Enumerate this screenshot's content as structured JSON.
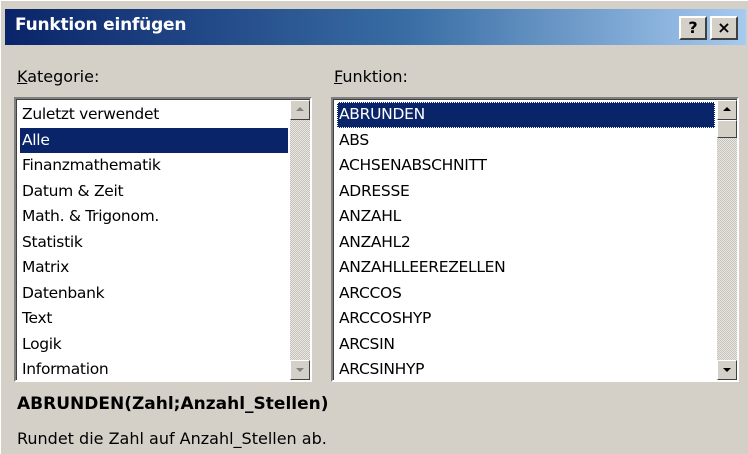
{
  "window": {
    "title": "Funktion einfügen",
    "help_button": "?",
    "close_button": "×"
  },
  "category": {
    "label_mnemonic": "K",
    "label_rest": "ategorie:",
    "items": [
      "Zuletzt verwendet",
      "Alle",
      "Finanzmathematik",
      "Datum & Zeit",
      "Math. & Trigonom.",
      "Statistik",
      "Matrix",
      "Datenbank",
      "Text",
      "Logik",
      "Information"
    ],
    "selected": "Alle"
  },
  "function": {
    "label_mnemonic": "F",
    "label_rest": "unktion:",
    "items": [
      "ABRUNDEN",
      "ABS",
      "ACHSENABSCHNITT",
      "ADRESSE",
      "ANZAHL",
      "ANZAHL2",
      "ANZAHLLEEREZELLEN",
      "ARCCOS",
      "ARCCOSHYP",
      "ARCSIN",
      "ARCSINHYP"
    ],
    "selected": "ABRUNDEN"
  },
  "syntax": "ABRUNDEN(Zahl;Anzahl_Stellen)",
  "description": "Rundet die Zahl auf Anzahl_Stellen ab.",
  "colors": {
    "selection": "#0a246a",
    "title_gradient_start": "#0a246a",
    "title_gradient_end": "#a6caf0",
    "dialog_face": "#d4d0c8"
  }
}
